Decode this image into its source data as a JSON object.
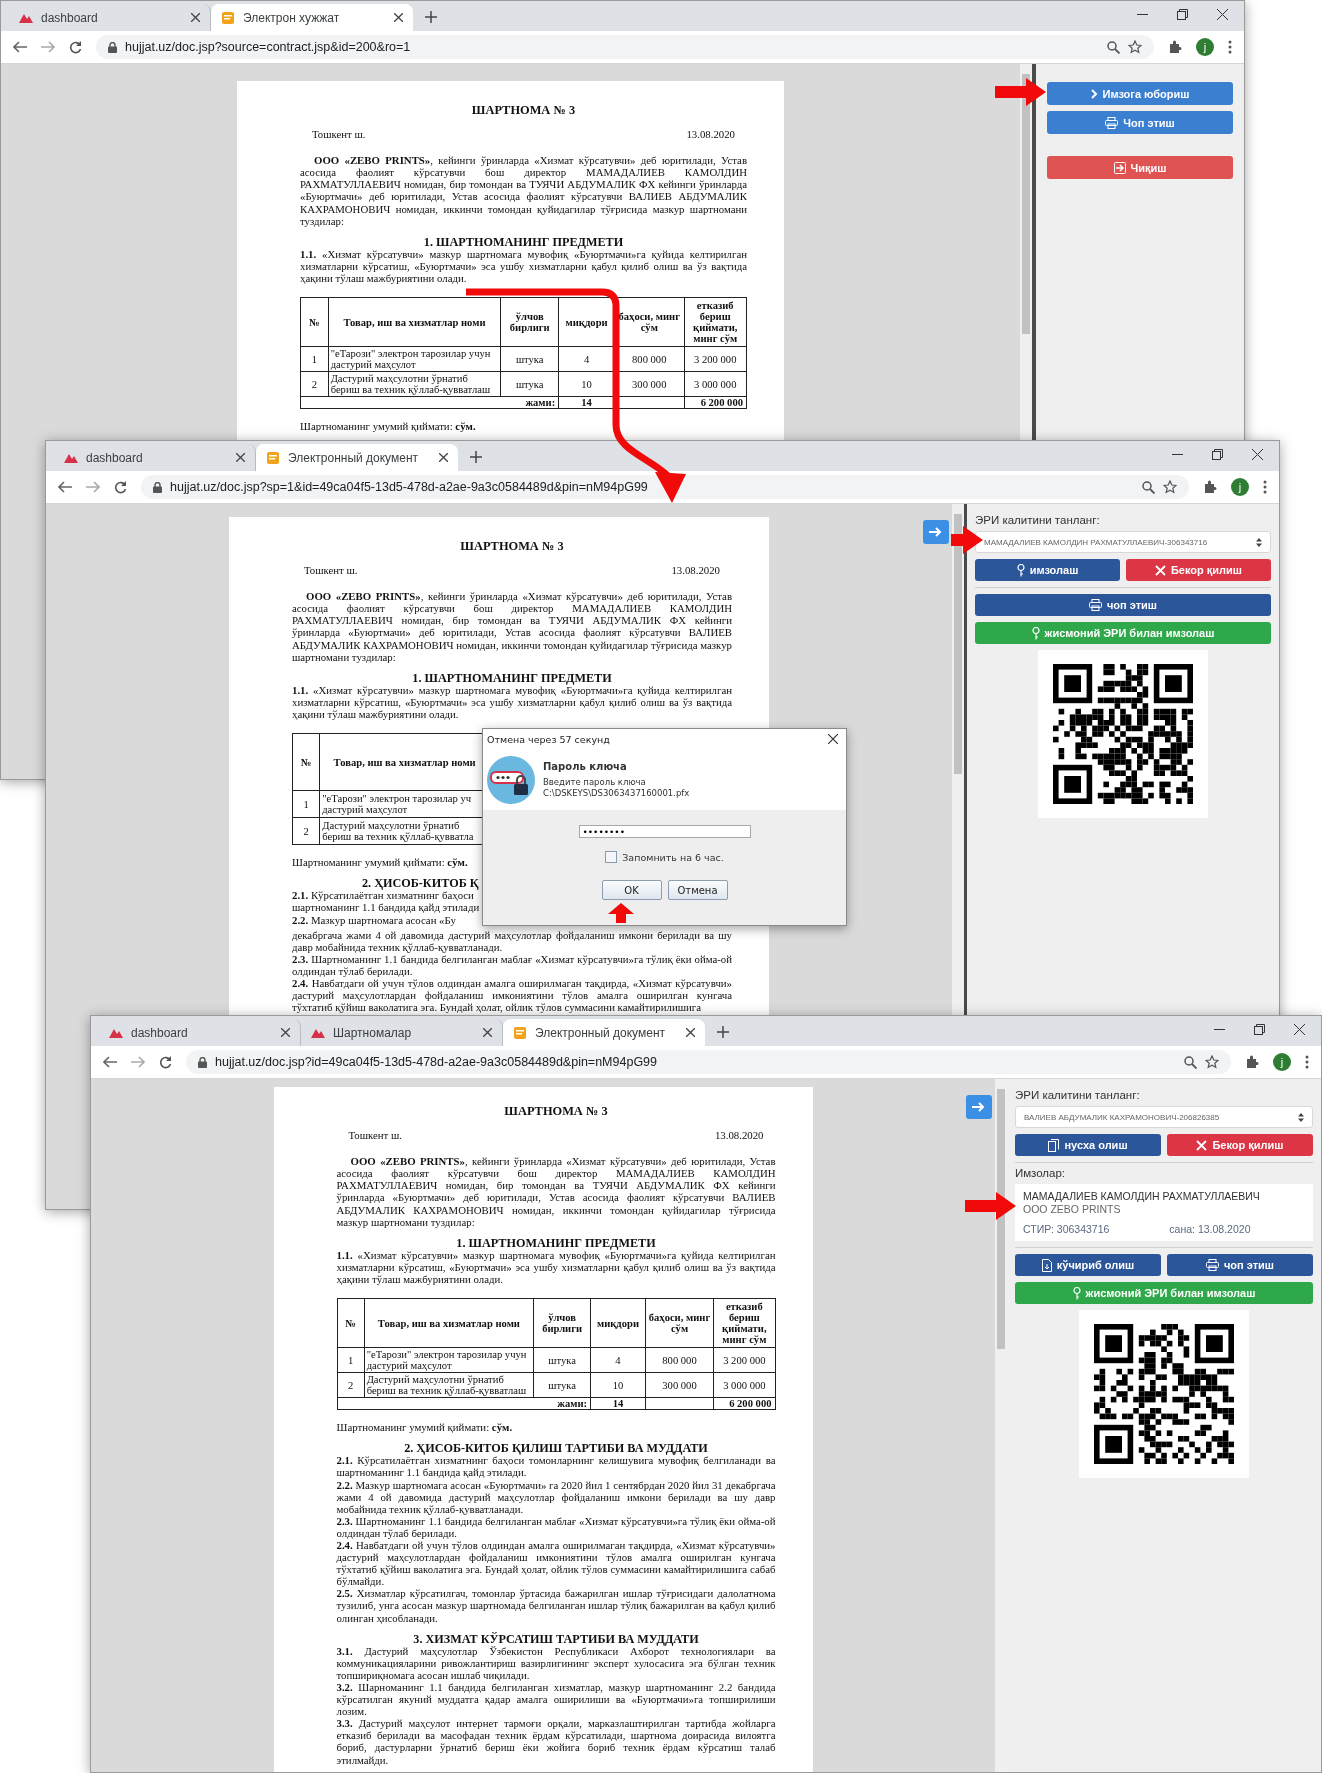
{
  "windows": [
    {
      "tabs": [
        {
          "label": "dashboard",
          "kind": "logo",
          "selected": false
        },
        {
          "label": "Электрон хужжат",
          "kind": "doc",
          "selected": true
        }
      ],
      "url": "hujjat.uz/doc.jsp?source=contract.jsp&id=200&ro=1",
      "avatar": "j",
      "document": {
        "blocks": [
          {
            "kind": "title",
            "text": "ШАРТНОМА № 3"
          },
          {
            "kind": "place_date",
            "place": "Тошкент ш.",
            "date": "13.08.2020"
          },
          {
            "kind": "intro",
            "text": "**ООО «ZEBO PRINTS»**, кейинги ўринларда «Хизмат кўрсатувчи» деб юритилади, Устав асосида фаолият кўрсатувчи бош директор МАМАДАЛИЕВ КАМОЛДИН РАХМАТУЛЛАЕВИЧ номидан, бир томондан ва ТУЯЧИ АБДУМАЛИК ФХ кейинги ўринларда «Буюртмачи» деб юритилади, Устав асосида фаолият кўрсатувчи ВАЛИЕВ АБДУМАЛИК КАХРАМОНОВИЧ номидан, иккинчи томондан қуйидагилар тўғрисида мазкур шартномани туздилар:"
          },
          {
            "kind": "heading",
            "text": "1. ШАРТНОМАНИНГ ПРЕДМЕТИ"
          },
          {
            "kind": "para",
            "text": "**1.1.** «Хизмат кўрсатувчи» мазкур шартномага мувофиқ «Буюртмачи»га қуйида келтирилган хизматларни кўрсатиш, «Буюртмачи» эса ушбу хизматларни қабул қилиб олиш ва ўз вақтида ҳақини тўлаш мажбуриятини олади."
          },
          {
            "kind": "table",
            "columns": [
              "№",
              "Товар, иш ва хизматлар номи",
              "ўлчов бирлиги",
              "миқдори",
              "баҳоси, минг сўм",
              "етказиб бериш қиймати, минг сўм"
            ],
            "rows": [
              [
                "1",
                "\"eТарози\" электрон тарозилар учун дастурий маҳсулот",
                "штука",
                "4",
                "800 000",
                "3 200 000"
              ],
              [
                "2",
                "Дастурий маҳсулотни ўрнатиб бериш ва техник қўллаб-қувватлаш",
                "штука",
                "10",
                "300 000",
                "3 000 000"
              ]
            ],
            "total": {
              "label": "жами:",
              "quantity": "14",
              "sum": "6 200 000"
            }
          },
          {
            "kind": "para",
            "text": "Шартноманинг умумий қиймати: **сўм.**"
          }
        ]
      },
      "panel": {
        "items": [
          {
            "kind": "stack",
            "buttons": [
              {
                "label": "Имзога юбориш",
                "kind": "send",
                "color": "#3a7fd0"
              },
              {
                "label": "Чоп этиш",
                "kind": "print",
                "color": "#3a7fd0"
              }
            ]
          },
          {
            "kind": "stack",
            "buttons": [
              {
                "label": "Чиқиш",
                "kind": "exit",
                "color": "#df5353"
              }
            ]
          }
        ]
      }
    },
    {
      "tabs": [
        {
          "label": "dashboard",
          "kind": "logo",
          "selected": false
        },
        {
          "label": "Электронный документ",
          "kind": "doc",
          "selected": true
        }
      ],
      "url": "hujjat.uz/doc.jsp?sp=1&id=49ca04f5-13d5-478d-a2ae-9a3c0584489d&pin=nM94pG99",
      "avatar": "j",
      "document": {
        "toggle_button": true,
        "blocks": [
          {
            "kind": "title",
            "text": "ШАРТНОМА № 3"
          },
          {
            "kind": "place_date",
            "place": "Тошкент ш.",
            "date": "13.08.2020"
          },
          {
            "kind": "intro",
            "text": "**ООО «ZEBO PRINTS»**, кейинги ўринларда «Хизмат кўрсатувчи» деб юритилади, Устав асосида фаолият кўрсатувчи бош директор МАМАДАЛИЕВ КАМОЛДИН РАХМАТУЛЛАЕВИЧ номидан, бир томондан ва ТУЯЧИ АБДУМАЛИК ФХ кейинги ўринларда «Буюртмачи» деб юритилади, Устав асосида фаолият кўрсатувчи ВАЛИЕВ АБДУМАЛИК КАХРАМОНОВИЧ номидан, иккинчи томондан қуйидагилар тўғрисида мазкур шартномани туздилар:"
          },
          {
            "kind": "heading",
            "text": "1. ШАРТНОМАНИНГ ПРЕДМЕТИ"
          },
          {
            "kind": "para",
            "text": "**1.1.** «Хизмат кўрсатувчи» мазкур шартномага мувофиқ «Буюртмачи»га қуйида келтирилган хизматларни кўрсатиш, «Буюртмачи» эса ушбу хизматларни қабул қилиб олиш ва ўз вақтида ҳақини тўлаш мажбуриятини олади."
          },
          {
            "kind": "table",
            "columns": [
              "№",
              "Товар, иш ва хизматлар номи"
            ],
            "rows": [
              [
                "1",
                "\"eТарози\" электрон тарозилар уч\nдастурий маҳсулот"
              ],
              [
                "2",
                "Дастурий маҳсулотни ўрнатиб\nбериш ва техник қўллаб-қувватла"
              ]
            ]
          },
          {
            "kind": "para_cut",
            "text": "Шартноманинг умумий қиймати: **сўм.**"
          },
          {
            "kind": "heading_cut",
            "text": "2. ҲИСОБ-КИТОБ Қ"
          },
          {
            "kind": "para_cut",
            "text": "**2.1.** Кўрсатилаётган хизматнинг баҳоси\nшартноманинг 1.1 бандида қайд этилади"
          },
          {
            "kind": "para_cut",
            "text": "**2.2.** Мазкур шартномага асосан «Бу"
          },
          {
            "kind": "para_cont",
            "text": "декабргача жами 4 ой давомида дастурий маҳсулотлар фойдаланиш имкони берилади ва шу давр мобайнида техник қўллаб-қувватланади."
          },
          {
            "kind": "para",
            "text": "**2.3.** Шартноманинг 1.1 бандида белгиланган маблағ «Хизмат кўрсатувчи»га тўлиқ ёки ойма-ой олдиндан тўлаб берилади."
          },
          {
            "kind": "para",
            "text": "**2.4.** Навбатдаги ой учун тўлов олдиндан амалга оширилмаган тақдирда, «Хизмат кўрсатувчи» дастурий маҳсулотлардан фойдаланиш имкониятини тўлов амалга оширилган кунгача тўхтатиб қўйиш ваколатига эга. Бундай ҳолат, ойлик тўлов суммасини камайтирилишига"
          }
        ]
      },
      "panel": {
        "items": [
          {
            "kind": "label",
            "text": "ЭРИ калитини танланг:"
          },
          {
            "kind": "select",
            "text": "МАМАДАЛИЕВ КАМОЛДИН РАХМАТУЛЛАЕВИЧ-306343716"
          },
          {
            "kind": "row",
            "buttons": [
              {
                "label": "имзолаш",
                "kind": "sign",
                "color": "#2b5699"
              },
              {
                "label": "Бекор қилиш",
                "kind": "cancel",
                "color": "#dc3545"
              }
            ]
          },
          {
            "kind": "row",
            "buttons": [
              {
                "label": "чоп этиш",
                "kind": "print",
                "color": "#2b5699"
              }
            ]
          },
          {
            "kind": "row",
            "buttons": [
              {
                "label": "жисмоний ЭРИ билан имзолаш",
                "kind": "sign",
                "color": "#2ea84a"
              }
            ]
          },
          {
            "kind": "qr"
          }
        ]
      },
      "dialog": {
        "title": "Отмена через 57 секунд",
        "heading": "Пароль ключа",
        "prompt": "Введите пароль ключа",
        "path": "C:\\DSKEYS\\DS3063437160001.pfx",
        "password": "••••••••",
        "remember": {
          "label": "Запомнить на 6 час.",
          "checked": false
        },
        "buttons": [
          "OK",
          "Отмена"
        ]
      }
    },
    {
      "tabs": [
        {
          "label": "dashboard",
          "kind": "logo",
          "selected": false
        },
        {
          "label": "Шартномалар",
          "kind": "logo",
          "selected": false
        },
        {
          "label": "Электронный документ",
          "kind": "doc",
          "selected": true
        }
      ],
      "url": "hujjat.uz/doc.jsp?id=49ca04f5-13d5-478d-a2ae-9a3c0584489d&pin=nM94pG99",
      "avatar": "j",
      "document": {
        "toggle_button": true,
        "blocks": [
          {
            "kind": "title",
            "text": "ШАРТНОМА № 3"
          },
          {
            "kind": "place_date",
            "place": "Тошкент ш.",
            "date": "13.08.2020"
          },
          {
            "kind": "intro",
            "text": "**ООО «ZEBO PRINTS»**, кейинги ўринларда «Хизмат кўрсатувчи» деб юритилади, Устав асосида фаолият кўрсатувчи бош директор МАМАДАЛИЕВ КАМОЛДИН РАХМАТУЛЛАЕВИЧ номидан, бир томондан ва ТУЯЧИ АБДУМАЛИК ФХ кейинги ўринларда «Буюртмачи» деб юритилади, Устав асосида фаолият кўрсатувчи ВАЛИЕВ АБДУМАЛИК КАХРАМОНОВИЧ номидан, иккинчи томондан қуйидагилар тўғрисида мазкур шартномани туздилар:"
          },
          {
            "kind": "heading",
            "text": "1. ШАРТНОМАНИНГ ПРЕДМЕТИ"
          },
          {
            "kind": "para",
            "text": "**1.1.** «Хизмат кўрсатувчи» мазкур шартномага мувофиқ «Буюртмачи»га қуйида келтирилган хизматларни кўрсатиш, «Буюртмачи» эса ушбу хизматларни қабул қилиб олиш ва ўз вақтида ҳақини тўлаш мажбуриятини олади."
          },
          {
            "kind": "table",
            "columns": [
              "№",
              "Товар, иш ва хизматлар номи",
              "ўлчов бирлиги",
              "миқдори",
              "баҳоси, минг сўм",
              "етказиб бериш қиймати, минг сўм"
            ],
            "rows": [
              [
                "1",
                "\"eТарози\" электрон тарозилар учун дастурий маҳсулот",
                "штука",
                "4",
                "800 000",
                "3 200 000"
              ],
              [
                "2",
                "Дастурий маҳсулотни ўрнатиб бериш ва техник қўллаб-қувватлаш",
                "штука",
                "10",
                "300 000",
                "3 000 000"
              ]
            ],
            "total": {
              "label": "жами:",
              "quantity": "14",
              "sum": "6 200 000"
            }
          },
          {
            "kind": "para",
            "text": "Шартноманинг умумий қиймати: **сўм.**"
          },
          {
            "kind": "heading",
            "text": "2. ҲИСОБ-КИТОБ ҚИЛИШ ТАРТИБИ ВА МУДДАТИ"
          },
          {
            "kind": "para",
            "text": "**2.1.** Кўрсатилаётган хизматнинг баҳоси томонларнинг келишувига мувофиқ белгиланади ва шартноманинг 1.1 бандида қайд этилади."
          },
          {
            "kind": "para",
            "text": "**2.2.** Мазкур шартномага асосан «Буюртмачи» га 2020 йил 1 сентябрдан 2020 йил 31 декабргача жами 4 ой давомида дастурий маҳсулотлар фойдаланиш имкони берилади ва шу давр мобайнида техник қўллаб-қувватланади."
          },
          {
            "kind": "para",
            "text": "**2.3.** Шартноманинг 1.1 бандида белгиланган маблағ «Хизмат кўрсатувчи»га тўлиқ ёки ойма-ой олдиндан тўлаб берилади."
          },
          {
            "kind": "para",
            "text": "**2.4.** Навбатдаги ой учун тўлов олдиндан амалга оширилмаган тақдирда, «Хизмат кўрсатувчи» дастурий маҳсулотлардан фойдаланиш имкониятини тўлов амалга оширилган кунгача тўхтатиб қўйиш ваколатига эга. Бундай ҳолат, ойлик тўлов суммасини камайтирилишига сабаб бўлмайди."
          },
          {
            "kind": "para",
            "text": "**2.5.** Хизматлар кўрсатилгач, томонлар ўртасида бажарилган ишлар тўғрисидаги далолатнома тузилиб, унга асосан мазкур шартномада белгиланган ишлар тўлиқ бажарилган ва қабул қилиб олинган ҳисобланади."
          },
          {
            "kind": "heading",
            "text": "3. ХИЗМАТ КЎРСАТИШ ТАРТИБИ ВА МУДДАТИ"
          },
          {
            "kind": "para",
            "text": "**3.1.** Дастурий маҳсулотлар Ўзбекистон Республикаси Ахборот технологиялари ва коммуникацияларини ривожлантириш вазирлигининг эксперт хулосасига эга бўлган техник топшириқномага асосан ишлаб чиқилади."
          },
          {
            "kind": "para",
            "text": "**3.2.** Шарноманинг 1.1 бандида белгиланган хизматлар, мазкур шартноманинг 2.2 бандида кўрсатилган якуний муддатга қадар амалга оширилиши ва «Буюртмачи»га топширилиши лозим."
          },
          {
            "kind": "para",
            "text": "**3.3.** Дастурий маҳсулот интернет тармоғи орқали, марказлаштирилган тартибда жойларга етказиб берилади ва масофадан техник ёрдам кўрсатилади, шартнома доирасида вилоятга бориб, дастурларни ўрнатиб бериш ёки жойига бориб техник ёрдам кўрсатиш талаб этилмайди."
          }
        ]
      },
      "panel": {
        "items": [
          {
            "kind": "label",
            "text": "ЭРИ калитини танланг:"
          },
          {
            "kind": "select",
            "text": "ВАЛИЕВ АБДУМАЛИК КАХРАМОНОВИЧ-206826385"
          },
          {
            "kind": "row",
            "buttons": [
              {
                "label": "нусха олиш",
                "kind": "copy",
                "color": "#2b5699"
              },
              {
                "label": "Бекор қилиш",
                "kind": "cancel",
                "color": "#dc3545"
              }
            ]
          },
          {
            "kind": "label",
            "text": "Имзолар:"
          },
          {
            "kind": "signature",
            "name": "МАМАДАЛИЕВ КАМОЛДИН РАХМАТУЛЛАЕВИЧ",
            "org": "ООО ZEBO PRINTS",
            "tin": "СТИР: 306343716",
            "date": "сана: 13.08.2020"
          },
          {
            "kind": "row",
            "buttons": [
              {
                "label": "кўчириб олиш",
                "kind": "download",
                "color": "#2b5699"
              },
              {
                "label": "чоп этиш",
                "kind": "print",
                "color": "#2b5699"
              }
            ]
          },
          {
            "kind": "row",
            "buttons": [
              {
                "label": "жисмоний ЭРИ билан имзолаш",
                "kind": "sign",
                "color": "#2ea84a"
              }
            ]
          },
          {
            "kind": "qr"
          }
        ]
      }
    }
  ]
}
